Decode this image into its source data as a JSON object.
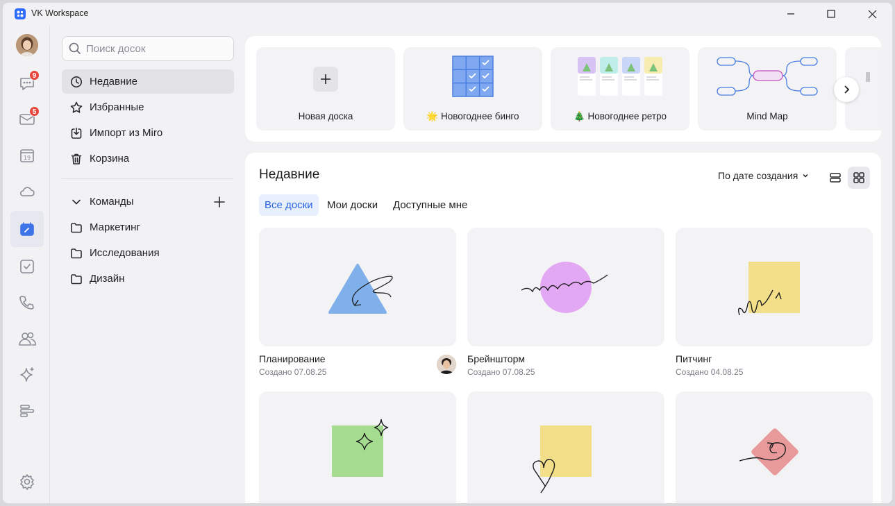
{
  "window": {
    "title": "VK Workspace"
  },
  "rail": {
    "chat_badge": "9",
    "mail_badge": "5",
    "calendar_day": "19"
  },
  "nav": {
    "search_placeholder": "Поиск досок",
    "items": [
      {
        "label": "Недавние",
        "icon": "clock-icon"
      },
      {
        "label": "Избранные",
        "icon": "star-icon"
      },
      {
        "label": "Импорт из Miro",
        "icon": "import-icon"
      },
      {
        "label": "Корзина",
        "icon": "trash-icon"
      }
    ],
    "teams_label": "Команды",
    "teams": [
      {
        "label": "Маркетинг"
      },
      {
        "label": "Исследования"
      },
      {
        "label": "Дизайн"
      }
    ]
  },
  "templates": [
    {
      "label": "Новая доска"
    },
    {
      "label": "🌟 Новогоднее бинго"
    },
    {
      "label": "🎄 Новогоднее ретро"
    },
    {
      "label": "Mind Map"
    }
  ],
  "recent": {
    "title": "Недавние",
    "sort_label": "По дате создания",
    "tabs": [
      {
        "label": "Все доски",
        "active": true
      },
      {
        "label": "Мои доски",
        "active": false
      },
      {
        "label": "Доступные мне",
        "active": false
      }
    ],
    "boards": [
      {
        "name": "Планирование",
        "date": "Создано 07.08.25"
      },
      {
        "name": "Брейншторм",
        "date": "Создано 07.08.25"
      },
      {
        "name": "Питчинг",
        "date": "Создано 04.08.25"
      },
      {
        "name": "",
        "date": ""
      },
      {
        "name": "",
        "date": ""
      },
      {
        "name": "",
        "date": ""
      }
    ]
  },
  "colors": {
    "accent": "#2f6bff",
    "badge": "#e8453c",
    "triangle": "#7fb0ea",
    "circle": "#e3a8f3",
    "sticky_yellow": "#f3df89",
    "sticky_green": "#a6dc90",
    "diamond": "#e8999a"
  }
}
